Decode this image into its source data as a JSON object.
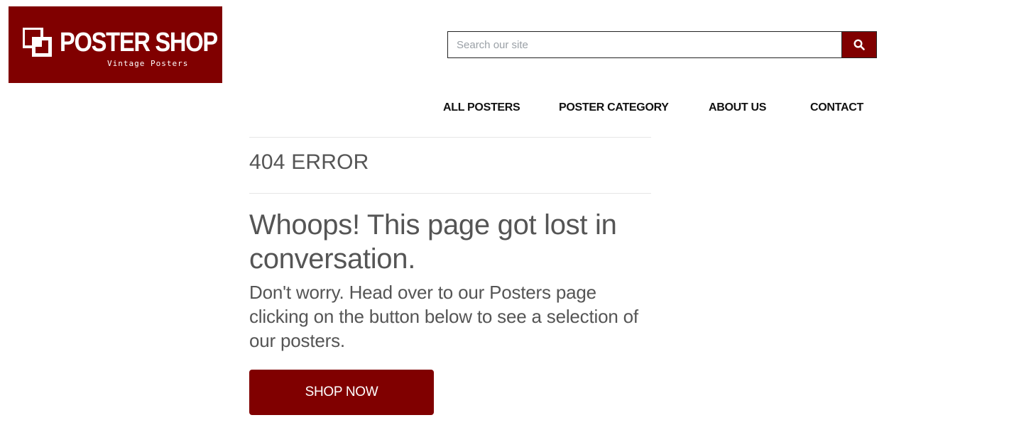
{
  "logo": {
    "title": "POSTER SHOP",
    "subtitle": "Vintage Posters",
    "background_color": "#800000"
  },
  "search": {
    "placeholder": "Search our site",
    "value": "",
    "button_icon": "search-icon"
  },
  "nav": {
    "items": [
      {
        "label": "ALL POSTERS"
      },
      {
        "label": "POSTER CATEGORY"
      },
      {
        "label": "ABOUT US"
      },
      {
        "label": "CONTACT"
      }
    ]
  },
  "main": {
    "error_title": "404 ERROR",
    "headline": "Whoops! This page got lost in conversation.",
    "body": "Don't worry. Head over to our Posters page clicking on the button below to see a selection of our posters.",
    "cta_label": "SHOP NOW"
  },
  "colors": {
    "brand": "#800000",
    "text": "#555555",
    "nav_text": "#111111"
  }
}
